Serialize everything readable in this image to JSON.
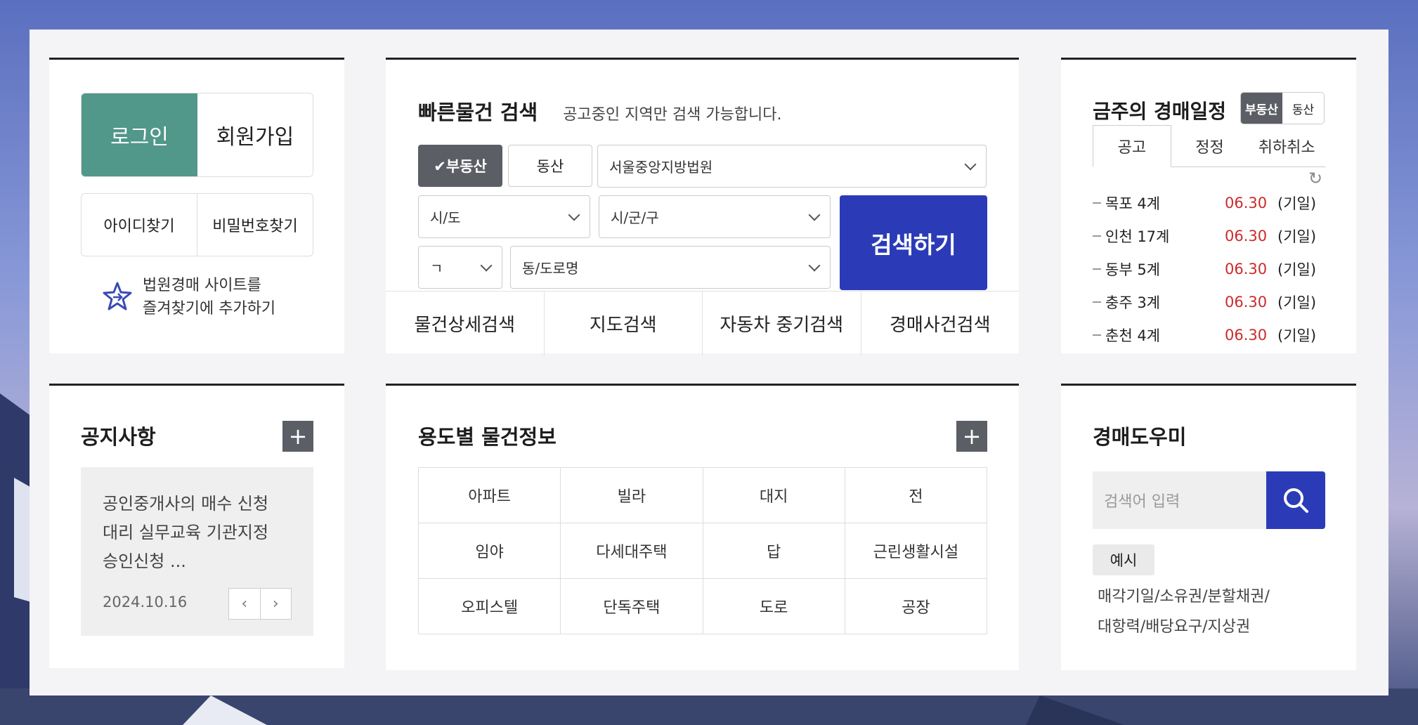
{
  "login": {
    "login_label": "로그인",
    "join_label": "회원가입",
    "find_id_label": "아이디찾기",
    "find_pw_label": "비밀번호찾기",
    "favorite_text_1": "법원경매 사이트를",
    "favorite_text_2": "즐겨찾기에 추가하기"
  },
  "quick_search": {
    "title": "빠른물건 검색",
    "subtitle": "공고중인 지역만 검색 가능합니다.",
    "tab_real_estate": "✔부동산",
    "tab_movable": "동산",
    "court_select": "서울중앙지방법원",
    "sido_select": "시/도",
    "sigungu_select": "시/군/구",
    "initial_select": "ㄱ",
    "dong_select": "동/도로명",
    "search_button": "검색하기",
    "sub_tabs": [
      "물건상세검색",
      "지도검색",
      "자동차 중기검색",
      "경매사건검색"
    ]
  },
  "schedule": {
    "title": "금주의 경매일정",
    "toggle_on": "부동산",
    "toggle_off": "동산",
    "tabs": [
      "공고",
      "정정",
      "취하취소"
    ],
    "items": [
      {
        "name": "목포 4계",
        "date": "06.30",
        "note": "(기일)"
      },
      {
        "name": "인천 17계",
        "date": "06.30",
        "note": "(기일)"
      },
      {
        "name": "동부 5계",
        "date": "06.30",
        "note": "(기일)"
      },
      {
        "name": "충주 3계",
        "date": "06.30",
        "note": "(기일)"
      },
      {
        "name": "춘천 4계",
        "date": "06.30",
        "note": "(기일)"
      }
    ]
  },
  "notice": {
    "title": "공지사항",
    "text": "공인중개사의 매수 신청대리 실무교육 기관지정승인신청 ...",
    "date": "2024.10.16"
  },
  "category": {
    "title": "용도별 물건정보",
    "items": [
      "아파트",
      "빌라",
      "대지",
      "전",
      "임야",
      "다세대주택",
      "답",
      "근린생활시설",
      "오피스텔",
      "단독주택",
      "도로",
      "공장"
    ]
  },
  "helper": {
    "title": "경매도우미",
    "placeholder": "검색어 입력",
    "example_label": "예시",
    "example_text_1": "매각기일/소유권/분할채권/",
    "example_text_2": "대항력/배당요구/지상권"
  },
  "colors": {
    "accent_green": "#51978a",
    "accent_blue": "#2b3bb8",
    "date_red": "#cc2a2a"
  }
}
